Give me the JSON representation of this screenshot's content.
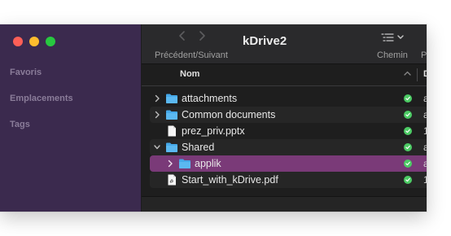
{
  "sidebar": {
    "sections": [
      "Favoris",
      "Emplacements",
      "Tags"
    ]
  },
  "toolbar": {
    "title": "kDrive2",
    "nav_label": "Précédent/Suivant",
    "path_label": "Chemin",
    "next_label": "P"
  },
  "columns": {
    "name": "Nom",
    "next": "D"
  },
  "files": [
    {
      "name": "attachments",
      "type": "folder",
      "expandable": true,
      "expanded": false,
      "indent": 0,
      "selected": false,
      "synced": true,
      "trail": "a"
    },
    {
      "name": "Common documents",
      "type": "folder",
      "expandable": true,
      "expanded": false,
      "indent": 0,
      "selected": false,
      "synced": true,
      "trail": "a"
    },
    {
      "name": "prez_priv.pptx",
      "type": "file",
      "expandable": false,
      "expanded": false,
      "indent": 0,
      "selected": false,
      "synced": true,
      "trail": "1"
    },
    {
      "name": "Shared",
      "type": "folder",
      "expandable": true,
      "expanded": true,
      "indent": 0,
      "selected": false,
      "synced": true,
      "trail": "a"
    },
    {
      "name": "applik",
      "type": "folder",
      "expandable": true,
      "expanded": false,
      "indent": 1,
      "selected": true,
      "synced": true,
      "trail": "a"
    },
    {
      "name": "Start_with_kDrive.pdf",
      "type": "pdf",
      "expandable": false,
      "expanded": false,
      "indent": 0,
      "selected": false,
      "synced": true,
      "trail": "1"
    }
  ],
  "colors": {
    "sidebar_bg": "#3b2a4e",
    "selection": "#7a3a78",
    "folder": "#45a8e8",
    "sync_ok": "#4ccb64"
  }
}
